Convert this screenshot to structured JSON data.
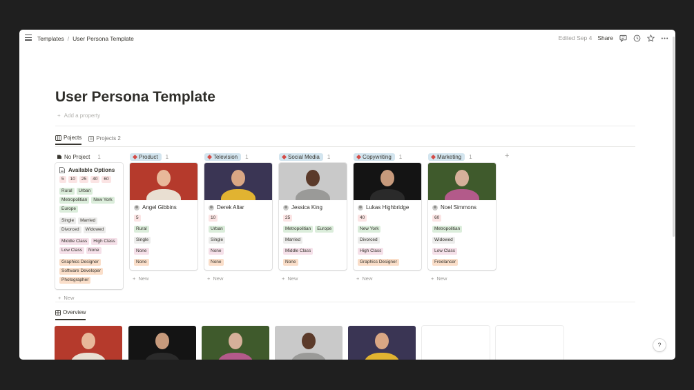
{
  "breadcrumb": {
    "parent": "Templates",
    "current": "User Persona Template"
  },
  "topbar": {
    "edited": "Edited Sep 4",
    "share": "Share"
  },
  "page": {
    "title": "User Persona Template",
    "add_property": "Add a property"
  },
  "views": [
    {
      "label": "Pojects"
    },
    {
      "label": "Projects 2"
    }
  ],
  "board": {
    "no_project": {
      "label": "No Project",
      "count": "1"
    },
    "available": {
      "title": "Available Options",
      "ages": [
        "5",
        "10",
        "25",
        "40",
        "60"
      ],
      "locations": [
        "Rural",
        "Urban",
        "Metropolitian",
        "New York",
        "Europe"
      ],
      "status": [
        "Single",
        "Married",
        "Divorced",
        "Widowed"
      ],
      "class": [
        "Middle Class",
        "High Class",
        "Low Class",
        "None"
      ],
      "jobs": [
        "Graphics Designer",
        "Software Developer",
        "Photographer"
      ]
    },
    "columns": [
      {
        "group": "Product",
        "count": "1",
        "name": "Angel Gibbins",
        "age": "5",
        "location": [
          "Rural"
        ],
        "status": "Single",
        "class": "None",
        "job": "None",
        "photo_bg": "#b53a2c",
        "skin": "#e8b89a",
        "cloth": "#e9dfd2"
      },
      {
        "group": "Television",
        "count": "1",
        "name": "Derek Altar",
        "age": "10",
        "location": [
          "Urban"
        ],
        "status": "Single",
        "class": "None",
        "job": "None",
        "photo_bg": "#3a3554",
        "skin": "#d9a784",
        "cloth": "#e1b331"
      },
      {
        "group": "Social Media",
        "count": "1",
        "name": "Jessica King",
        "age": "25",
        "location": [
          "Metropolitian",
          "Europe"
        ],
        "status": "Married",
        "class": "Middle Class",
        "job": "None",
        "photo_bg": "#c9c9c9",
        "skin": "#5b3a2a",
        "cloth": "#9a9a98"
      },
      {
        "group": "Copywriting",
        "count": "1",
        "name": "Lukas Highbridge",
        "age": "40",
        "location": [
          "New York"
        ],
        "status": "Divorced",
        "class": "High Class",
        "job": "Graphics Designer",
        "photo_bg": "#141414",
        "skin": "#c79a7c",
        "cloth": "#2a2a2a"
      },
      {
        "group": "Marketing",
        "count": "1",
        "name": "Noel Simmons",
        "age": "60",
        "location": [
          "Metropolitian"
        ],
        "status": "Widowed",
        "class": "Low Class",
        "job": "Freelancer",
        "photo_bg": "#3f5a2c",
        "skin": "#d6b09a",
        "cloth": "#b35a8a"
      }
    ],
    "new_label": "New"
  },
  "overview": {
    "label": "Overview"
  },
  "gallery_photos": [
    {
      "bg": "#b53a2c",
      "skin": "#e8b89a",
      "cloth": "#e9dfd2"
    },
    {
      "bg": "#141414",
      "skin": "#c79a7c",
      "cloth": "#2a2a2a"
    },
    {
      "bg": "#3f5a2c",
      "skin": "#d6b09a",
      "cloth": "#b35a8a"
    },
    {
      "bg": "#c9c9c9",
      "skin": "#5b3a2a",
      "cloth": "#9a9a98"
    },
    {
      "bg": "#3a3554",
      "skin": "#d9a784",
      "cloth": "#e1b331"
    }
  ],
  "colors": {
    "group_pill_bg": "#d3e5ef",
    "diamond": "#d44c47"
  },
  "help": "?"
}
